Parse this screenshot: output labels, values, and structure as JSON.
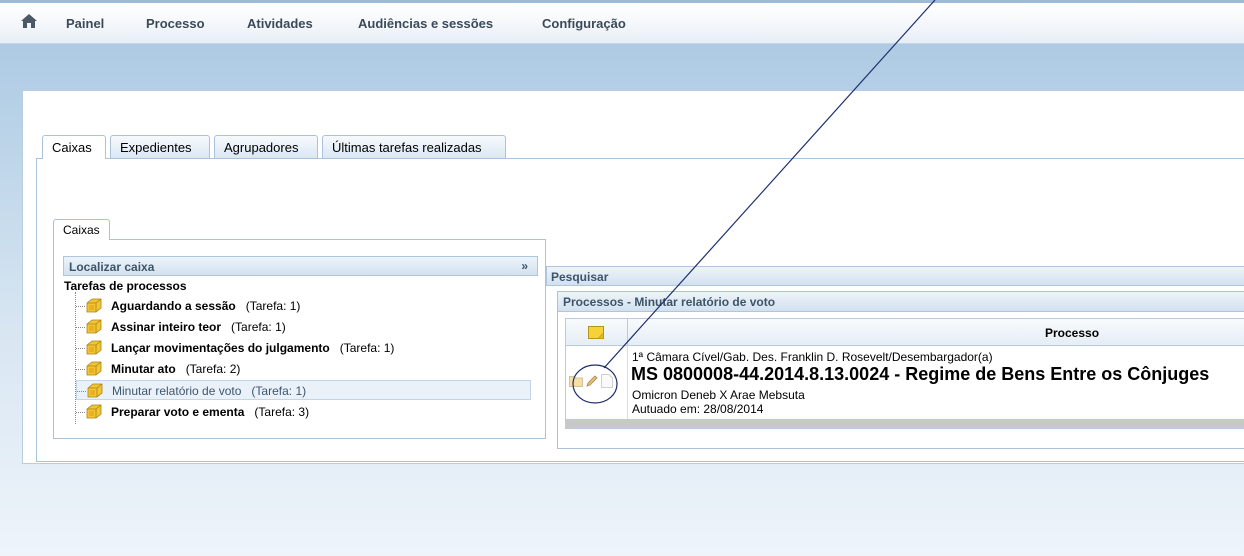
{
  "nav": {
    "items": [
      {
        "label": "Painel"
      },
      {
        "label": "Processo"
      },
      {
        "label": "Atividades"
      },
      {
        "label": "Audiências e sessões"
      },
      {
        "label": "Configuração"
      }
    ],
    "home_icon": "home-icon"
  },
  "tabs": [
    {
      "label": "Caixas",
      "active": true
    },
    {
      "label": "Expedientes",
      "active": false
    },
    {
      "label": "Agrupadores",
      "active": false
    },
    {
      "label": "Últimas tarefas realizadas",
      "active": false
    }
  ],
  "caixas": {
    "subtab": "Caixas",
    "localizar": "Localizar caixa",
    "localizar_chevron": "»",
    "tree_title": "Tarefas de processos",
    "items": [
      {
        "name": "Aguardando a sessão",
        "count": "(Tarefa: 1)",
        "selected": false
      },
      {
        "name": "Assinar inteiro teor",
        "count": "(Tarefa: 1)",
        "selected": false
      },
      {
        "name": "Lançar movimentações do julgamento",
        "count": "(Tarefa: 1)",
        "selected": false
      },
      {
        "name": "Minutar ato",
        "count": "(Tarefa: 2)",
        "selected": false
      },
      {
        "name": "Minutar relatório de voto",
        "count": "(Tarefa: 1)",
        "selected": true
      },
      {
        "name": "Preparar voto e ementa",
        "count": "(Tarefa: 3)",
        "selected": false
      }
    ]
  },
  "search": {
    "label": "Pesquisar"
  },
  "processos": {
    "panel_title": "Processos - Minutar relatório de voto",
    "column_processo": "Processo",
    "row": {
      "orgao": "1ª Câmara Cível/Gab. Des. Franklin D. Rosevelt/Desembargador(a)",
      "numero": "MS 0800008-44.2014.8.13.0024 - Regime de Bens Entre os Cônjuges",
      "partes": "Omicron Deneb X Arae Mebsuta",
      "autuado": "Autuado em: 28/08/2014"
    }
  },
  "colors": {
    "nav_text": "#3b4a59",
    "panel_header_text": "#3e5468",
    "annotation_line": "#1f2d6e"
  }
}
